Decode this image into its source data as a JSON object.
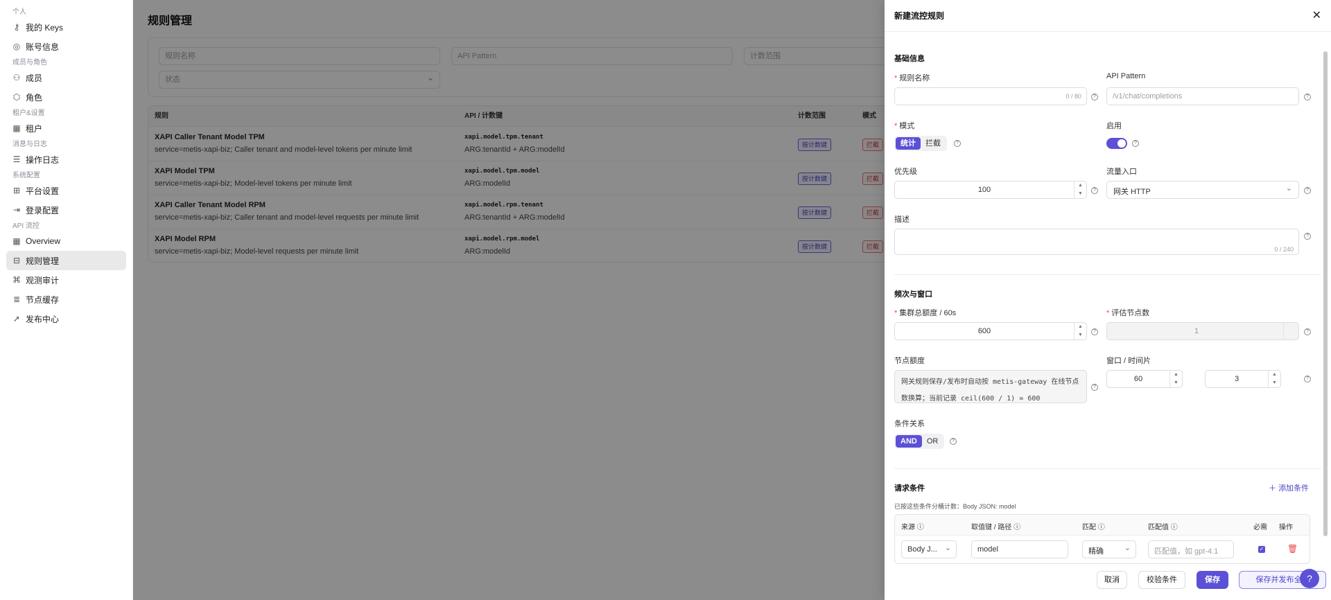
{
  "sidebar": {
    "groups": [
      {
        "label": "个人",
        "items": [
          {
            "label": "我的 Keys",
            "icon": "key-icon"
          },
          {
            "label": "账号信息",
            "icon": "user-circle-icon"
          }
        ]
      },
      {
        "label": "成员与角色",
        "items": [
          {
            "label": "成员",
            "icon": "users-icon"
          },
          {
            "label": "角色",
            "icon": "shield-icon"
          }
        ]
      },
      {
        "label": "租户&设置",
        "items": [
          {
            "label": "租户",
            "icon": "building-icon"
          }
        ]
      },
      {
        "label": "消息与日志",
        "items": [
          {
            "label": "操作日志",
            "icon": "log-icon"
          }
        ]
      },
      {
        "label": "系统配置",
        "items": [
          {
            "label": "平台设置",
            "icon": "settings-icon"
          },
          {
            "label": "登录配置",
            "icon": "login-icon"
          }
        ]
      },
      {
        "label": "API 流控",
        "items": [
          {
            "label": "Overview",
            "icon": "grid-icon"
          },
          {
            "label": "规则管理",
            "icon": "rules-icon",
            "active": true
          },
          {
            "label": "观测审计",
            "icon": "audit-icon"
          },
          {
            "label": "节点缓存",
            "icon": "database-icon"
          },
          {
            "label": "发布中心",
            "icon": "rocket-icon"
          }
        ]
      }
    ]
  },
  "main": {
    "title": "规则管理",
    "filters": {
      "rule_name": "规则名称",
      "api_pattern": "API Pattern",
      "scope": "计数范围",
      "status": "状态"
    },
    "table": {
      "headers": [
        "规则",
        "API / 计数键",
        "计数范围",
        "模式"
      ],
      "rows": [
        {
          "name": "XAPI Caller Tenant Model TPM",
          "desc": "service=metis-xapi-biz; Caller tenant and model-level tokens per minute limit",
          "api": "xapi.model.tpm.tenant",
          "dims": "ARG:tenantId + ARG:modelId",
          "scope": "按计数键",
          "mode": "拦截"
        },
        {
          "name": "XAPI Model TPM",
          "desc": "service=metis-xapi-biz; Model-level tokens per minute limit",
          "api": "xapi.model.tpm.model",
          "dims": "ARG:modelId",
          "scope": "按计数键",
          "mode": "拦截"
        },
        {
          "name": "XAPI Caller Tenant Model RPM",
          "desc": "service=metis-xapi-biz; Caller tenant and model-level requests per minute limit",
          "api": "xapi.model.rpm.tenant",
          "dims": "ARG:tenantId + ARG:modelId",
          "scope": "按计数键",
          "mode": "拦截"
        },
        {
          "name": "XAPI Model RPM",
          "desc": "service=metis-xapi-biz; Model-level requests per minute limit",
          "api": "xapi.model.rpm.model",
          "dims": "ARG:modelId",
          "scope": "按计数键",
          "mode": "拦截"
        }
      ]
    }
  },
  "drawer": {
    "title": "新建流控规则",
    "basic": {
      "section": "基础信息",
      "rule_name_label": "规则名称",
      "rule_name_count": "0 / 80",
      "api_pattern_label": "API Pattern",
      "api_pattern_placeholder": "/v1/chat/completions",
      "mode_label": "模式",
      "mode_options": [
        "统计",
        "拦截"
      ],
      "enabled_label": "启用",
      "priority_label": "优先级",
      "priority_value": "100",
      "entry_label": "流量入口",
      "entry_value": "网关 HTTP",
      "desc_label": "描述",
      "desc_count": "0 / 240"
    },
    "frequency": {
      "section": "频次与窗口",
      "cluster_label": "集群总额度 / 60s",
      "cluster_value": "600",
      "nodes_label": "评估节点数",
      "nodes_value": "1",
      "node_quota_label": "节点额度",
      "node_quota_text": "网关规则保存/发布时自动按 metis-gateway 在线节点数换算；当前记录 ceil(600 / 1) = 600",
      "window_label": "窗口 / 时间片",
      "window_value": "60",
      "slice_value": "3",
      "relation_label": "条件关系",
      "relation_options": [
        "AND",
        "OR"
      ]
    },
    "conditions": {
      "section": "请求条件",
      "add_label": "添加条件",
      "hint": "已按这些条件分桶计数：Body JSON: model",
      "headers": [
        "来源",
        "取值键 / 路径",
        "匹配",
        "匹配值",
        "必需",
        "操作"
      ],
      "row": {
        "source": "Body J...",
        "key": "model",
        "match": "精确",
        "value_placeholder": "匹配值，如 gpt-4.1"
      }
    },
    "footer": {
      "cancel": "取消",
      "validate": "校验条件",
      "save": "保存",
      "save_publish": "保存并发布全部"
    }
  },
  "colors": {
    "accent": "#5b50d6",
    "danger": "#e5484d"
  }
}
